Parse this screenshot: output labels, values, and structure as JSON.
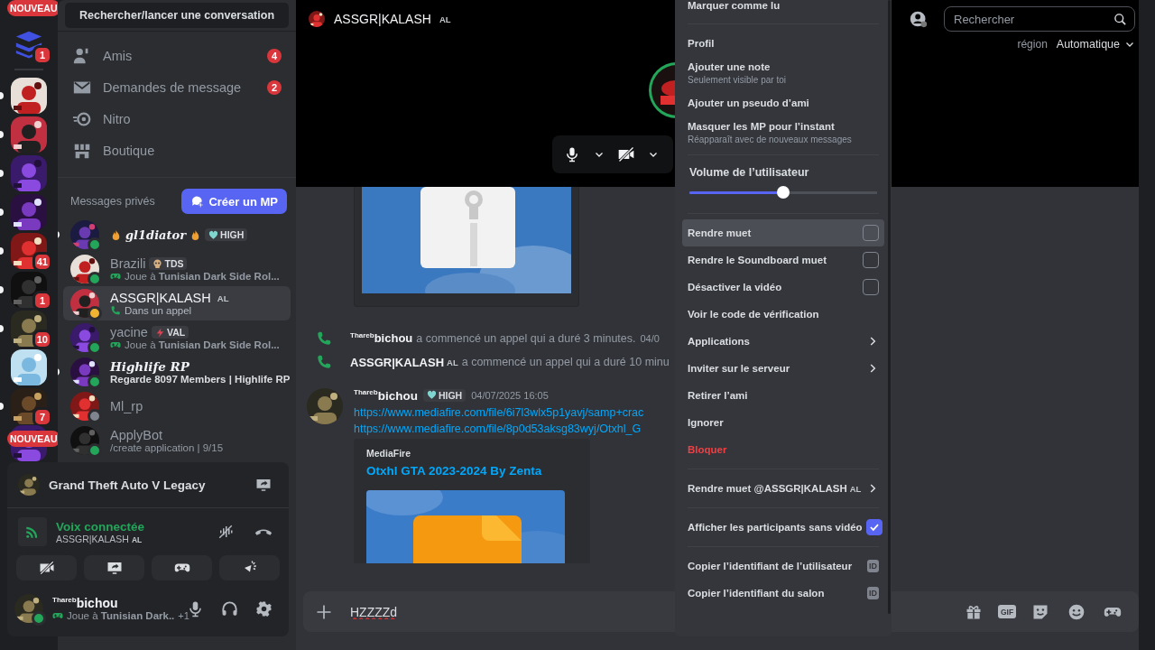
{
  "server_rail": {
    "items": [
      {
        "kind": "new",
        "label": "NOUVEAU"
      },
      {
        "kind": "logo",
        "badge": "1",
        "unread": false
      },
      {
        "kind": "server",
        "unread": true
      },
      {
        "kind": "server",
        "unread": true
      },
      {
        "kind": "server",
        "unread": true
      },
      {
        "kind": "server",
        "unread": true
      },
      {
        "kind": "server",
        "badge": "41",
        "unread": true
      },
      {
        "kind": "server",
        "badge": "1",
        "unread": true
      },
      {
        "kind": "server",
        "badge": "10",
        "unread": true
      },
      {
        "kind": "server",
        "unread": false
      },
      {
        "kind": "server",
        "badge": "7",
        "unread": true
      },
      {
        "kind": "new",
        "label": "NOUVEAU"
      }
    ]
  },
  "sidebar": {
    "search": "Rechercher/lancer une conversation",
    "nav": [
      {
        "kind": "friends",
        "label": "Amis",
        "badge": "4"
      },
      {
        "kind": "requests",
        "label": "Demandes de message",
        "badge": "2"
      },
      {
        "kind": "nitro",
        "label": "Nitro"
      },
      {
        "kind": "shop",
        "label": "Boutique"
      }
    ],
    "dm_header": "Messages privés",
    "create_dm": "Créer un MP",
    "dms": [
      {
        "kind": "fancy",
        "name": "gl1diator",
        "tag": {
          "kind": "heart",
          "text": "HIGH"
        },
        "color": "#23a55a",
        "selected": false,
        "unread": true
      },
      {
        "kind": "plain",
        "name": "Brazili",
        "tag": {
          "kind": "skull",
          "text": "TDS"
        },
        "activity": {
          "kind": "playing",
          "text": "Joue à **Tunisian Dark Side Rol...**"
        },
        "color": "#23a55a",
        "selected": false,
        "unread": false
      },
      {
        "kind": "plain",
        "name": "ASSGR|KALASH",
        "name_tag": "AL",
        "activity": {
          "kind": "call",
          "text": "Dans un appel"
        },
        "color": "#f0b232",
        "selected": true,
        "unread": false
      },
      {
        "kind": "plain",
        "name": "yacine",
        "tag": {
          "kind": "bolt",
          "text": "VAL"
        },
        "activity": {
          "kind": "playing",
          "text": "Joue à **Tunisian Dark Side Rol...**"
        },
        "color": "#23a55a",
        "selected": false,
        "unread": false
      },
      {
        "kind": "italic",
        "name": "Highlife RP",
        "activity": {
          "kind": "watching",
          "text": "Regarde 8097 Members | Highlife RP"
        },
        "color": "#23a55a",
        "selected": false,
        "unread": true
      },
      {
        "kind": "plain",
        "name": "Ml_rp",
        "color": "#80848e",
        "selected": false,
        "unread": false
      },
      {
        "kind": "plain",
        "name": "ApplyBot",
        "activity": {
          "kind": "custom",
          "text": "/create application | 9/15"
        },
        "color": "#23a55a",
        "selected": false,
        "unread": false
      }
    ],
    "panel": {
      "game": "Grand Theft Auto V Legacy",
      "voice_status": "Voix connectée",
      "voice_channel": "ASSGR|KALASH",
      "voice_channel_tag": "AL",
      "user": {
        "name": "$^{Thareb}$bichou",
        "activity": "Joue à **Tunisian Dark..**",
        "extra": "+1",
        "color": "#23a55a"
      }
    }
  },
  "video": {
    "title": "ASSGR|KALASH",
    "title_tag": "AL",
    "search_placeholder": "Rechercher",
    "region_label": "région",
    "region_value": "Automatique",
    "mic_on": true,
    "camera_on": false
  },
  "chat": {
    "items": [
      {
        "kind": "attachment"
      },
      {
        "kind": "call",
        "actor": "$^{Thareb}$bichou",
        "text": "a commencé un appel qui a duré 3 minutes.",
        "time": "04/0"
      },
      {
        "kind": "call",
        "actor": "ASSGR|KALASH",
        "actor_tag": "AL",
        "text": "a commencé un appel qui a duré 10 minu"
      },
      {
        "kind": "message",
        "author": "$^{Thareb}$bichou",
        "tag": {
          "kind": "heart",
          "text": "HIGH"
        },
        "time": "04/07/2025 16:05",
        "links": [
          "https://www.mediafire.com/file/6i7l3wlx5p1yavj/samp+crac",
          "https://www.mediafire.com/file/8p0d53aksg83wyj/Otxhl_G"
        ],
        "embed": {
          "provider": "MediaFire",
          "title": "Otxhl GTA 2023-2024 By Zenta"
        }
      }
    ],
    "composer": {
      "value": "HZZZZd",
      "gif_label": "GIF"
    }
  },
  "menu": [
    {
      "kind": "item",
      "label": "Marquer comme lu",
      "highlighted": false
    },
    {
      "kind": "separator"
    },
    {
      "kind": "item",
      "label": "Profil",
      "highlighted": false
    },
    {
      "kind": "item",
      "label": "Ajouter une note",
      "hint": "Seulement visible par toi",
      "highlighted": false
    },
    {
      "kind": "item",
      "label": "Ajouter un pseudo d’ami",
      "highlighted": false
    },
    {
      "kind": "item",
      "label": "Masquer les MP pour l’instant",
      "hint": "Réapparaît avec de nouveaux messages",
      "highlighted": false
    },
    {
      "kind": "separator"
    },
    {
      "kind": "slider",
      "label": "Volume de l’utilisateur",
      "level": 0.5
    },
    {
      "kind": "separator"
    },
    {
      "kind": "checkbox",
      "label": "Rendre muet",
      "checked": false,
      "highlighted": true
    },
    {
      "kind": "checkbox",
      "label": "Rendre le Soundboard muet",
      "checked": false,
      "highlighted": false
    },
    {
      "kind": "checkbox",
      "label": "Désactiver la vidéo",
      "checked": false,
      "highlighted": false
    },
    {
      "kind": "item",
      "label": "Voir le code de vérification",
      "highlighted": false
    },
    {
      "kind": "submenu",
      "label": "Applications",
      "highlighted": false
    },
    {
      "kind": "submenu",
      "label": "Inviter sur le serveur",
      "highlighted": false
    },
    {
      "kind": "item",
      "label": "Retirer l’ami",
      "highlighted": false
    },
    {
      "kind": "item",
      "label": "Ignorer",
      "highlighted": false
    },
    {
      "kind": "danger",
      "label": "Bloquer",
      "highlighted": false
    },
    {
      "kind": "separator"
    },
    {
      "kind": "submenu",
      "label": "Rendre muet @ASSGR|KALASH",
      "tag": "AL",
      "highlighted": false
    },
    {
      "kind": "separator"
    },
    {
      "kind": "checkbox",
      "label": "Afficher les participants sans vidéo",
      "checked": true,
      "highlighted": false
    },
    {
      "kind": "separator"
    },
    {
      "kind": "id",
      "label": "Copier l’identifiant de l’utilisateur",
      "badge": "ID",
      "highlighted": false
    },
    {
      "kind": "id",
      "label": "Copier l’identifiant du salon",
      "badge": "ID",
      "highlighted": false
    }
  ]
}
